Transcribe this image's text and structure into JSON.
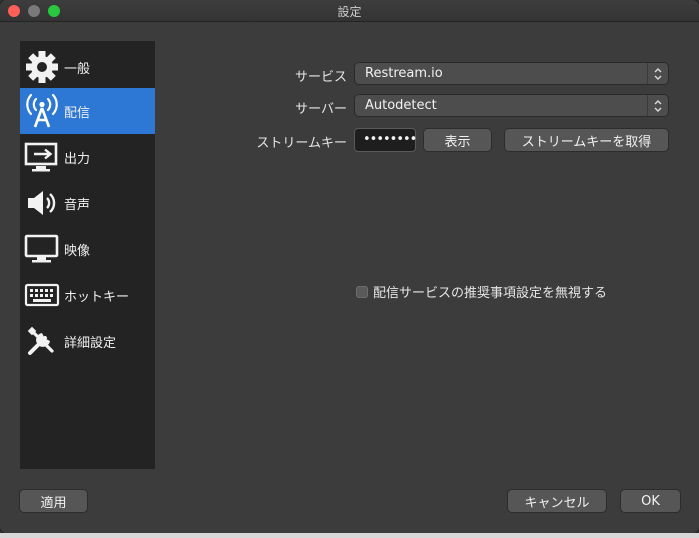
{
  "window": {
    "title": "設定"
  },
  "sidebar": {
    "items": [
      {
        "label": "一般",
        "icon": "gear-icon",
        "active": false
      },
      {
        "label": "配信",
        "icon": "broadcast-antenna-icon",
        "active": true
      },
      {
        "label": "出力",
        "icon": "output-monitor-icon",
        "active": false
      },
      {
        "label": "音声",
        "icon": "speaker-icon",
        "active": false
      },
      {
        "label": "映像",
        "icon": "monitor-icon",
        "active": false
      },
      {
        "label": "ホットキー",
        "icon": "keyboard-icon",
        "active": false
      },
      {
        "label": "詳細設定",
        "icon": "wrench-screwdriver-icon",
        "active": false
      }
    ]
  },
  "stream": {
    "service_label": "サービス",
    "service_value": "Restream.io",
    "server_label": "サーバー",
    "server_value": "Autodetect",
    "key_label": "ストリームキー",
    "key_value": "••••••••",
    "show_button": "表示",
    "get_key_button": "ストリームキーを取得",
    "ignore_checkbox_label": "配信サービスの推奨事項設定を無視する",
    "ignore_checked": false
  },
  "footer": {
    "apply": "適用",
    "cancel": "キャンセル",
    "ok": "OK"
  },
  "colors": {
    "active": "#2c78d4",
    "sidebar_bg": "#232323",
    "window_bg": "#3c3c3c"
  }
}
